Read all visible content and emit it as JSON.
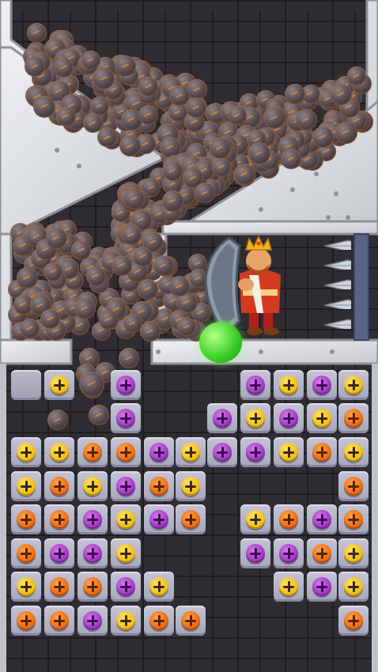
{
  "colors": {
    "yellow_screw": "#f1b90c",
    "orange_screw": "#e8640e",
    "purple_screw": "#9a2fbf",
    "steel_wall": "#d9dbdf",
    "brick": "#2f2d31",
    "gem": "#3fd12b",
    "king_robe": "#d33a22"
  },
  "icons": {
    "screw": "screw-icon",
    "rock": "rock-ball-icon",
    "spike": "spike-icon",
    "gem": "green-gem-icon",
    "hero": "king-with-shield"
  },
  "board": {
    "rows": [
      [
        "blank",
        "yellow",
        "ball",
        "purple",
        null,
        null,
        null,
        "purple",
        "yellow",
        "purple",
        "yellow"
      ],
      [
        null,
        null,
        null,
        "purple",
        null,
        null,
        "purple",
        "yellow",
        "purple",
        "yellow",
        "orange"
      ],
      [
        "yellow",
        "yellow",
        "orange",
        "orange",
        "purple",
        "yellow",
        "purple",
        "purple",
        "yellow",
        "orange",
        "yellow"
      ],
      [
        "yellow",
        "orange",
        "yellow",
        "purple",
        "orange",
        "yellow",
        null,
        null,
        null,
        null,
        "orange"
      ],
      [
        "orange",
        "orange",
        "purple",
        "yellow",
        "purple",
        "orange",
        null,
        "yellow",
        "orange",
        "purple",
        "orange"
      ],
      [
        "orange",
        "purple",
        "purple",
        "yellow",
        null,
        null,
        null,
        "purple",
        "purple",
        "orange",
        "yellow"
      ],
      [
        "yellow",
        "orange",
        "orange",
        "purple",
        "yellow",
        null,
        null,
        null,
        "yellow",
        "purple",
        "yellow"
      ],
      [
        "orange",
        "orange",
        "purple",
        "yellow",
        "orange",
        "orange",
        null,
        null,
        null,
        null,
        "orange"
      ]
    ]
  },
  "chamber": {
    "spike_count": 5
  }
}
